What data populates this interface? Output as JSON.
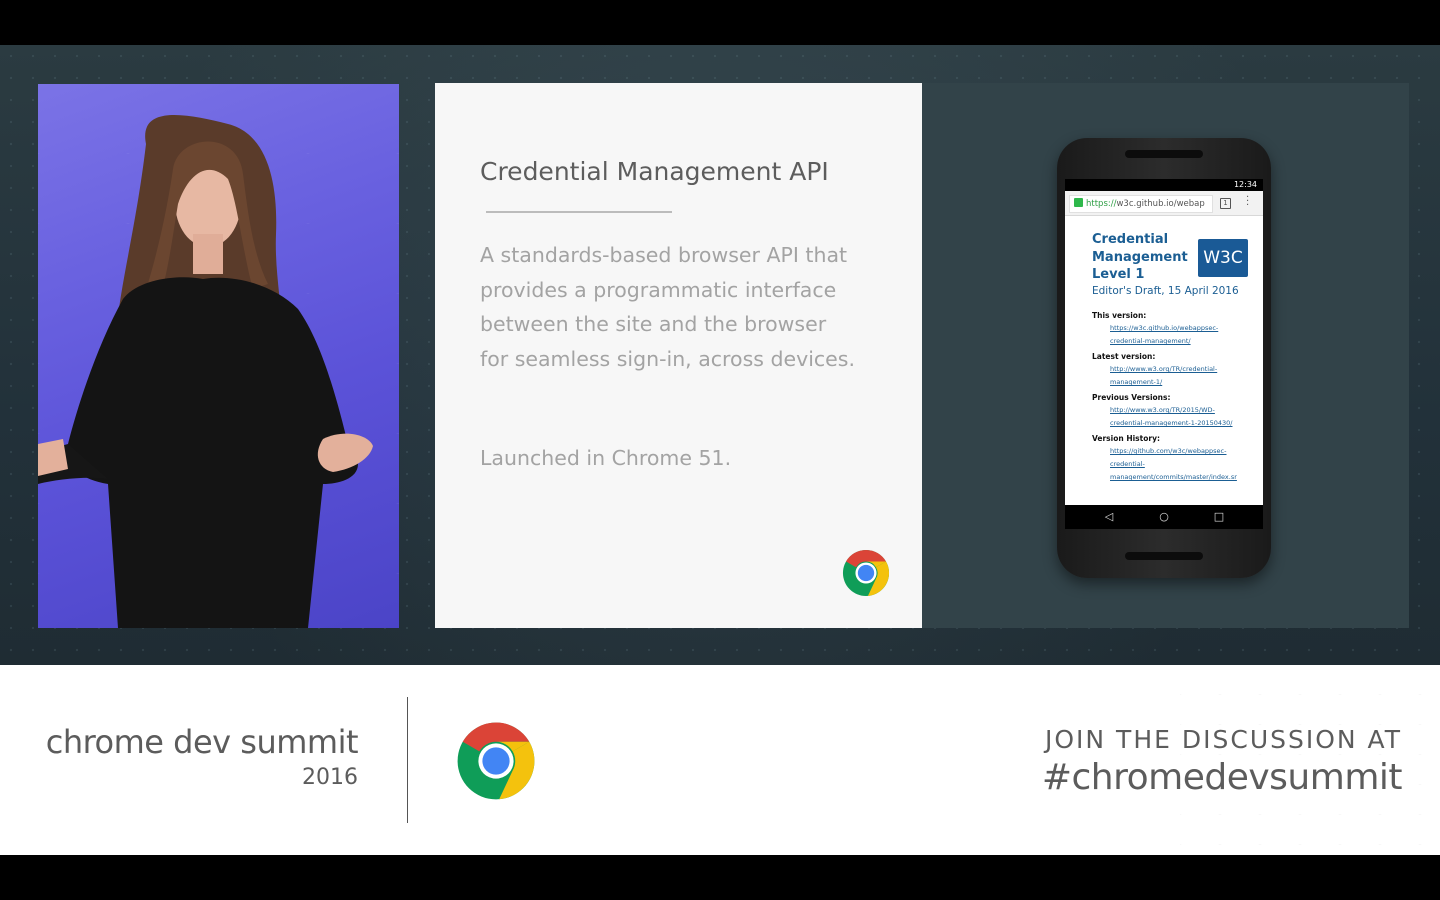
{
  "slide": {
    "title": "Credential Management API",
    "body_lines": [
      "A standards-based browser API that",
      "provides a programmatic interface",
      "between the site and the browser",
      "for seamless sign-in, across devices."
    ],
    "launched": "Launched in Chrome 51."
  },
  "phone": {
    "status_time": "12:34",
    "url_scheme": "https://",
    "url_rest": "w3c.github.io/webap",
    "doc_title_lines": [
      "Credential",
      "Management",
      "Level 1"
    ],
    "w3c_logo": "W3C",
    "doc_date": "Editor's Draft, 15 April 2016",
    "sections": [
      {
        "label": "This version:",
        "links": [
          "https://w3c.github.io/webappsec-",
          "credential-management/"
        ]
      },
      {
        "label": "Latest version:",
        "links": [
          "http://www.w3.org/TR/credential-",
          "management-1/"
        ]
      },
      {
        "label": "Previous Versions:",
        "links": [
          "http://www.w3.org/TR/2015/WD-",
          "credential-management-1-20150430/"
        ]
      },
      {
        "label": "Version History:",
        "links": [
          "https://github.com/w3c/webappsec-",
          "credential-",
          "management/commits/master/index.sr"
        ]
      }
    ]
  },
  "lower_third": {
    "brand": "chrome dev summit",
    "year": "2016",
    "join": "JOIN THE DISCUSSION AT",
    "hashtag": "#chromedevsummit"
  },
  "colors": {
    "chrome_red": "#db4437",
    "chrome_yellow": "#f4c20d",
    "chrome_green": "#0f9d58",
    "chrome_blue": "#4285f4",
    "stage_bg": "#2b3b41",
    "w3c_blue": "#1a5a96"
  },
  "icons": [
    "chrome-logo-icon",
    "lock-icon",
    "tab-switcher-icon",
    "overflow-menu-icon",
    "back-icon",
    "home-icon",
    "recents-icon"
  ]
}
